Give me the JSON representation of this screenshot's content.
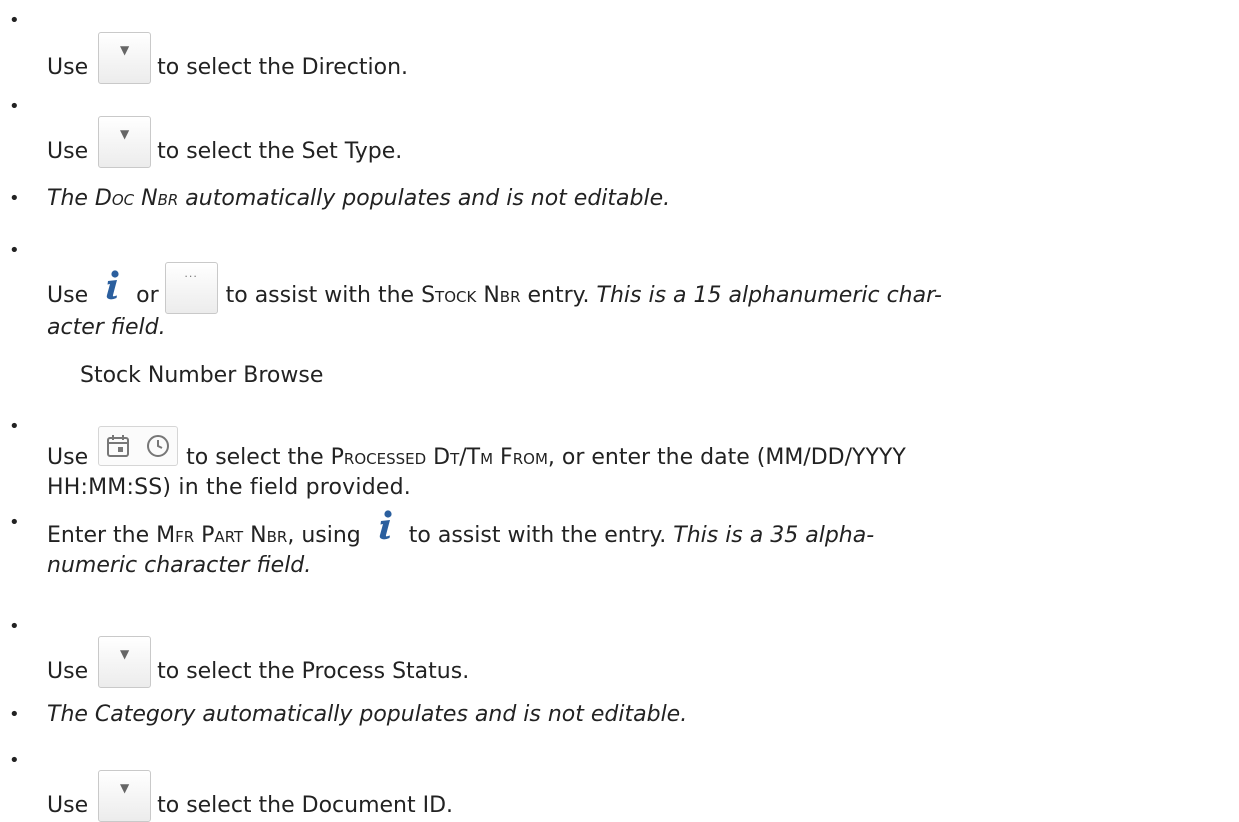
{
  "bullet": "•",
  "items": {
    "direction": {
      "use": "Use",
      "text": "to select the Direction."
    },
    "set_type": {
      "use": "Use",
      "text": "to select the Set Type."
    },
    "doc_nbr": {
      "pre": "The ",
      "term": "Doc Nbr",
      "post": " automatically populates and is not editable."
    },
    "stock_nbr": {
      "use": "Use",
      "or": "or",
      "pre": "to assist with the ",
      "term": "Stock Nbr",
      "post": " entry. ",
      "note_line1": "This is a 15 alphanumeric char-",
      "note_line2": "acter field.",
      "sub": "Stock Number Browse"
    },
    "processed_dt": {
      "use": "Use",
      "pre": "to select the ",
      "term": "Processed Dt/Tm From",
      "post": ", or enter the date (MM/DD/YYYY",
      "line2": "HH:MM:SS) in the field provided."
    },
    "mfr_part": {
      "pre": "Enter the ",
      "term": "Mfr Part Nbr",
      "mid": ", using",
      "post": "to assist with the entry. ",
      "note_line1": "This is a 35 alpha-",
      "note_line2": "numeric character field."
    },
    "process_status": {
      "use": "Use",
      "text": "to select the Process Status."
    },
    "category": {
      "text": "The Category automatically populates and is not editable."
    },
    "document_id": {
      "use": "Use",
      "text": "to select the Document ID."
    }
  },
  "icons": {
    "dropdown": "chevron-down-icon",
    "info": "info-icon",
    "browse": "ellipsis-icon",
    "calendar": "calendar-icon",
    "clock": "clock-icon",
    "accent_blue": "#2b5f9e"
  }
}
